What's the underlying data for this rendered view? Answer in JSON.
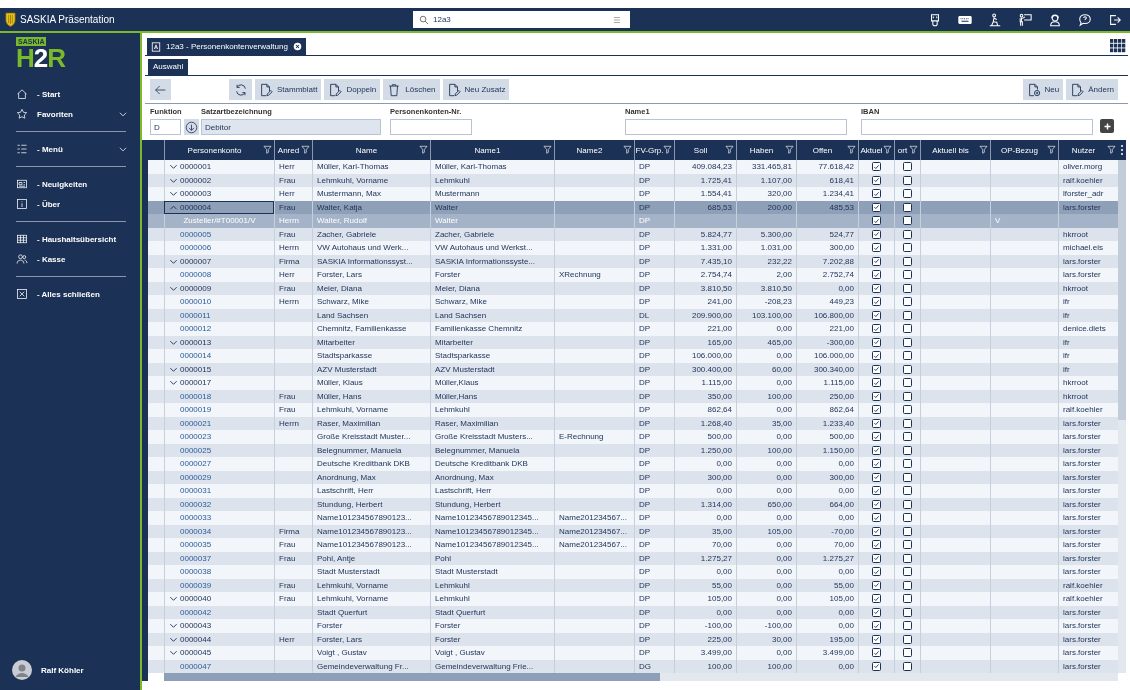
{
  "window": {
    "title": "SASKIA Präsentation"
  },
  "search": {
    "value": "12a3"
  },
  "sidebar": {
    "logo_badge": "SASKIA",
    "logo_mark": "H2R",
    "groups": [
      [
        {
          "label": "- Start",
          "submenu": false
        },
        {
          "label": "Favoriten",
          "submenu": true
        }
      ],
      [
        {
          "label": "- Menü",
          "submenu": true
        }
      ],
      [
        {
          "label": "- Neuigkeiten",
          "submenu": false
        },
        {
          "label": "- Über",
          "submenu": false
        }
      ],
      [
        {
          "label": "- Haushaltsübersicht",
          "submenu": false
        },
        {
          "label": "- Kasse",
          "submenu": false
        }
      ],
      [
        {
          "label": "- Alles schließen",
          "submenu": false
        }
      ]
    ],
    "user": {
      "name": "Ralf Köhler"
    }
  },
  "document_tabs": [
    {
      "title": "12a3 - Personenkontenverwaltung",
      "selected": true
    }
  ],
  "subtabs": [
    {
      "label": "Auswahl",
      "selected": true
    }
  ],
  "toolbar": {
    "center": [
      {
        "label": "Stammblatt"
      },
      {
        "label": "Doppeln"
      },
      {
        "label": "Löschen"
      },
      {
        "label": "Neu Zusatz"
      }
    ],
    "right": [
      {
        "label": "Neu"
      },
      {
        "label": "Ändern"
      }
    ]
  },
  "filters": [
    {
      "label": "Funktion",
      "value": "D",
      "kind": "code"
    },
    {
      "label": "Satzartbezeichnung",
      "value": "Debitor",
      "kind": "readonly"
    },
    {
      "label": "Personenkonten-Nr.",
      "kind": "text"
    },
    {
      "label": "Name1",
      "kind": "text"
    },
    {
      "label": "IBAN",
      "kind": "text"
    }
  ],
  "table": {
    "columns": [
      {
        "label": "Personenkonto",
        "kind": "tree"
      },
      {
        "label": "Anred",
        "kind": "text"
      },
      {
        "label": "Name",
        "kind": "text"
      },
      {
        "label": "Name1",
        "kind": "text"
      },
      {
        "label": "Name2",
        "kind": "text"
      },
      {
        "label": "FV-Grp.",
        "kind": "text"
      },
      {
        "label": "Soll",
        "kind": "number"
      },
      {
        "label": "Haben",
        "kind": "number"
      },
      {
        "label": "Offen",
        "kind": "number"
      },
      {
        "label": "Aktuel",
        "kind": "check"
      },
      {
        "label": "ort",
        "kind": "check"
      },
      {
        "label": "Aktuell bis",
        "kind": "text"
      },
      {
        "label": "OP-Bezug",
        "kind": "text"
      },
      {
        "label": "Nutzer",
        "kind": "text"
      }
    ],
    "rows": [
      {
        "kind": "group",
        "expanded": false,
        "selected": false,
        "konto": "0000001",
        "anrede": "Herr",
        "name": "Müller, Karl-Thomas",
        "name1": "Müller, Karl-Thomas",
        "fv": "DP",
        "soll": "409.084,23",
        "haben": "331.465,81",
        "offen": "77.618,42",
        "aktuell": true,
        "ort": false,
        "nutzer": "oliver.morg"
      },
      {
        "kind": "group",
        "expanded": false,
        "selected": false,
        "konto": "0000002",
        "anrede": "Frau",
        "name": "Lehmkuhl, Vorname",
        "name1": "Lehmkuhl",
        "fv": "DP",
        "soll": "1.725,41",
        "haben": "1.107,00",
        "offen": "618,41",
        "aktuell": true,
        "ort": false,
        "nutzer": "ralf.koehler"
      },
      {
        "kind": "group",
        "expanded": false,
        "selected": false,
        "konto": "0000003",
        "anrede": "Herr",
        "name": "Mustermann, Max",
        "name1": "Mustermann",
        "fv": "DP",
        "soll": "1.554,41",
        "haben": "320,00",
        "offen": "1.234,41",
        "aktuell": true,
        "ort": false,
        "nutzer": "lforster_adr"
      },
      {
        "kind": "group",
        "expanded": true,
        "selected": true,
        "konto": "0000004",
        "anrede": "Frau",
        "name": "Walter, Katja",
        "name1": "Walter",
        "fv": "DP",
        "soll": "685,53",
        "haben": "200,00",
        "offen": "485,53",
        "aktuell": true,
        "ort": false,
        "nutzer": "lars.forster"
      },
      {
        "kind": "sub",
        "selected": false,
        "konto": "Zusteller/#T00001/V",
        "anrede": "Herrn",
        "name": "Walter, Rudolf",
        "name1": "Walter",
        "fv": "DP",
        "aktuell": true,
        "ort": false,
        "op_bezug": "V"
      },
      {
        "kind": "leaf",
        "selected": false,
        "konto": "0000005",
        "anrede": "Frau",
        "name": "Zacher, Gabriele",
        "name1": "Zacher, Gabriele",
        "fv": "DP",
        "soll": "5.824,77",
        "haben": "5.300,00",
        "offen": "524,77",
        "aktuell": true,
        "ort": false,
        "nutzer": "hkrroot"
      },
      {
        "kind": "leaf",
        "selected": false,
        "konto": "0000006",
        "anrede": "Herrn",
        "name": "VW Autohaus und Werk...",
        "name1": "VW Autohaus und Werkst...",
        "fv": "DP",
        "soll": "1.331,00",
        "haben": "1.031,00",
        "offen": "300,00",
        "aktuell": true,
        "ort": false,
        "nutzer": "michael.eis"
      },
      {
        "kind": "group",
        "expanded": false,
        "selected": false,
        "konto": "0000007",
        "anrede": "Firma",
        "name": "SASKIA Informationssyst...",
        "name1": "SASKIA Informationssyste...",
        "fv": "DP",
        "soll": "7.435,10",
        "haben": "232,22",
        "offen": "7.202,88",
        "aktuell": true,
        "ort": false,
        "nutzer": "lars.forster"
      },
      {
        "kind": "leaf",
        "selected": false,
        "konto": "0000008",
        "anrede": "Herr",
        "name": "Forster, Lars",
        "name1": "Forster",
        "name2": "XRechnung",
        "fv": "DP",
        "soll": "2.754,74",
        "haben": "2,00",
        "offen": "2.752,74",
        "aktuell": true,
        "ort": false,
        "nutzer": "lars.forster"
      },
      {
        "kind": "group",
        "expanded": false,
        "selected": false,
        "konto": "0000009",
        "anrede": "Frau",
        "name": "Meier, Diana",
        "name1": "Meier, Diana",
        "fv": "DP",
        "soll": "3.810,50",
        "haben": "3.810,50",
        "offen": "0,00",
        "aktuell": true,
        "ort": false,
        "nutzer": "hkrroot"
      },
      {
        "kind": "leaf",
        "selected": false,
        "konto": "0000010",
        "anrede": "Herrn",
        "name": "Schwarz, Mike",
        "name1": "Schwarz, Mike",
        "fv": "DP",
        "soll": "241,00",
        "haben": "-208,23",
        "offen": "449,23",
        "aktuell": true,
        "ort": false,
        "nutzer": "ifr"
      },
      {
        "kind": "leaf",
        "selected": false,
        "konto": "0000011",
        "name": "Land Sachsen",
        "name1": "Land Sachsen",
        "fv": "DL",
        "soll": "209.900,00",
        "haben": "103.100,00",
        "offen": "106.800,00",
        "aktuell": true,
        "ort": false,
        "nutzer": "ifr"
      },
      {
        "kind": "leaf",
        "selected": false,
        "konto": "0000012",
        "name": "Chemnitz, Familienkasse",
        "name1": "Familienkasse Chemnitz",
        "fv": "DP",
        "soll": "221,00",
        "haben": "0,00",
        "offen": "221,00",
        "aktuell": true,
        "ort": false,
        "nutzer": "denice.diets"
      },
      {
        "kind": "group",
        "expanded": false,
        "selected": false,
        "konto": "0000013",
        "name": "Mitarbeiter",
        "name1": "Mitarbeiter",
        "fv": "DP",
        "soll": "165,00",
        "haben": "465,00",
        "offen": "-300,00",
        "aktuell": true,
        "ort": false,
        "nutzer": "ifr"
      },
      {
        "kind": "leaf",
        "selected": false,
        "konto": "0000014",
        "name": "Stadtsparkasse",
        "name1": "Stadtsparkasse",
        "fv": "DP",
        "soll": "106.000,00",
        "haben": "0,00",
        "offen": "106.000,00",
        "aktuell": true,
        "ort": false,
        "nutzer": "ifr"
      },
      {
        "kind": "group",
        "expanded": false,
        "selected": false,
        "konto": "0000015",
        "name": "AZV Musterstadt",
        "name1": "AZV Musterstadt",
        "fv": "DP",
        "soll": "300.400,00",
        "haben": "60,00",
        "offen": "300.340,00",
        "aktuell": true,
        "ort": false,
        "nutzer": "ifr"
      },
      {
        "kind": "group",
        "expanded": false,
        "selected": false,
        "konto": "0000017",
        "name": "Müller, Klaus",
        "name1": "Müller,Klaus",
        "fv": "DP",
        "soll": "1.115,00",
        "haben": "0,00",
        "offen": "1.115,00",
        "aktuell": true,
        "ort": false,
        "nutzer": "hkrroot"
      },
      {
        "kind": "leaf",
        "selected": false,
        "konto": "0000018",
        "anrede": "Frau",
        "name": "Müller, Hans",
        "name1": "Müller,Hans",
        "fv": "DP",
        "soll": "350,00",
        "haben": "100,00",
        "offen": "250,00",
        "aktuell": true,
        "ort": false,
        "nutzer": "hkrroot"
      },
      {
        "kind": "leaf",
        "selected": false,
        "konto": "0000019",
        "anrede": "Frau",
        "name": "Lehmkuhl, Vorname",
        "name1": "Lehmkuhl",
        "fv": "DP",
        "soll": "862,64",
        "haben": "0,00",
        "offen": "862,64",
        "aktuell": true,
        "ort": false,
        "nutzer": "ralf.koehler"
      },
      {
        "kind": "leaf",
        "selected": false,
        "konto": "0000021",
        "anrede": "Herrn",
        "name": "Raser, Maximilian",
        "name1": "Raser, Maximilian",
        "fv": "DP",
        "soll": "1.268,40",
        "haben": "35,00",
        "offen": "1.233,40",
        "aktuell": true,
        "ort": false,
        "nutzer": "lars.forster"
      },
      {
        "kind": "leaf",
        "selected": false,
        "konto": "0000023",
        "name": "Große Kreisstadt Muster...",
        "name1": "Große Kreisstadt Musters...",
        "name2": "E-Rechnung",
        "fv": "DP",
        "soll": "500,00",
        "haben": "0,00",
        "offen": "500,00",
        "aktuell": true,
        "ort": false,
        "nutzer": "lars.forster"
      },
      {
        "kind": "leaf",
        "selected": false,
        "konto": "0000025",
        "name": "Belegnummer, Manuela",
        "name1": "Belegnummer, Manuela",
        "fv": "DP",
        "soll": "1.250,00",
        "haben": "100,00",
        "offen": "1.150,00",
        "aktuell": true,
        "ort": false,
        "nutzer": "lars.forster"
      },
      {
        "kind": "leaf",
        "selected": false,
        "konto": "0000027",
        "name": "Deutsche Kreditbank DKB",
        "name1": "Deutsche Kreditbank DKB",
        "fv": "DP",
        "soll": "0,00",
        "haben": "0,00",
        "offen": "0,00",
        "aktuell": true,
        "ort": false,
        "nutzer": "lars.forster"
      },
      {
        "kind": "leaf",
        "selected": false,
        "konto": "0000029",
        "name": "Anordnung, Max",
        "name1": "Anordnung, Max",
        "fv": "DP",
        "soll": "300,00",
        "haben": "0,00",
        "offen": "300,00",
        "aktuell": true,
        "ort": false,
        "nutzer": "lars.forster"
      },
      {
        "kind": "leaf",
        "selected": false,
        "konto": "0000031",
        "name": "Lastschrift, Herr",
        "name1": "Lastschrift, Herr",
        "fv": "DP",
        "soll": "0,00",
        "haben": "0,00",
        "offen": "0,00",
        "aktuell": true,
        "ort": false,
        "nutzer": "lars.forster"
      },
      {
        "kind": "leaf",
        "selected": false,
        "konto": "0000032",
        "name": "Stundung, Herbert",
        "name1": "Stundung, Herbert",
        "fv": "DP",
        "soll": "1.314,00",
        "haben": "650,00",
        "offen": "664,00",
        "aktuell": true,
        "ort": false,
        "nutzer": "lars.forster"
      },
      {
        "kind": "leaf",
        "selected": false,
        "konto": "0000033",
        "name": "Name101234567890123...",
        "name1": "Name10123456789012345...",
        "name2": "Name201234567...",
        "fv": "DP",
        "soll": "0,00",
        "haben": "0,00",
        "offen": "0,00",
        "aktuell": true,
        "ort": false,
        "nutzer": "lars.forster"
      },
      {
        "kind": "leaf",
        "selected": false,
        "konto": "0000034",
        "anrede": "Firma",
        "name": "Name101234567890123...",
        "name1": "Name10123456789012345...",
        "name2": "Name201234567...",
        "fv": "DP",
        "soll": "35,00",
        "haben": "105,00",
        "offen": "-70,00",
        "aktuell": true,
        "ort": false,
        "nutzer": "lars.forster"
      },
      {
        "kind": "leaf",
        "selected": false,
        "konto": "0000035",
        "anrede": "Frau",
        "name": "Name101234567890123...",
        "name1": "Name10123456789012345...",
        "name2": "Name201234567...",
        "fv": "DP",
        "soll": "70,00",
        "haben": "0,00",
        "offen": "70,00",
        "aktuell": true,
        "ort": false,
        "nutzer": "lars.forster"
      },
      {
        "kind": "leaf",
        "selected": false,
        "konto": "0000037",
        "anrede": "Frau",
        "name": "Pohl, Antje",
        "name1": "Pohl",
        "fv": "DP",
        "soll": "1.275,27",
        "haben": "0,00",
        "offen": "1.275,27",
        "aktuell": true,
        "ort": false,
        "nutzer": "lars.forster"
      },
      {
        "kind": "leaf",
        "selected": false,
        "konto": "0000038",
        "name": "Stadt Musterstadt",
        "name1": "Stadt Musterstadt",
        "fv": "DP",
        "soll": "0,00",
        "haben": "0,00",
        "offen": "0,00",
        "aktuell": true,
        "ort": false,
        "nutzer": "lars.forster"
      },
      {
        "kind": "leaf",
        "selected": false,
        "konto": "0000039",
        "anrede": "Frau",
        "name": "Lehmkuhl, Vorname",
        "name1": "Lehmkuhl",
        "fv": "DP",
        "soll": "55,00",
        "haben": "0,00",
        "offen": "55,00",
        "aktuell": true,
        "ort": false,
        "nutzer": "ralf.koehler"
      },
      {
        "kind": "group",
        "expanded": false,
        "selected": false,
        "konto": "0000040",
        "anrede": "Frau",
        "name": "Lehmkuhl, Vorname",
        "name1": "Lehmkuhl",
        "fv": "DP",
        "soll": "105,00",
        "haben": "0,00",
        "offen": "105,00",
        "aktuell": true,
        "ort": false,
        "nutzer": "ralf.koehler"
      },
      {
        "kind": "leaf",
        "selected": false,
        "konto": "0000042",
        "name": "Stadt Querfurt",
        "name1": "Stadt Querfurt",
        "fv": "DP",
        "soll": "0,00",
        "haben": "0,00",
        "offen": "0,00",
        "aktuell": true,
        "ort": false,
        "nutzer": "lars.forster"
      },
      {
        "kind": "group",
        "expanded": false,
        "selected": false,
        "konto": "0000043",
        "name": "Forster",
        "name1": "Forster",
        "fv": "DP",
        "soll": "-100,00",
        "haben": "-100,00",
        "offen": "0,00",
        "aktuell": true,
        "ort": false,
        "nutzer": "lars.forster"
      },
      {
        "kind": "group",
        "expanded": false,
        "selected": false,
        "konto": "0000044",
        "anrede": "Herr",
        "name": "Forster, Lars",
        "name1": "Forster",
        "fv": "DP",
        "soll": "225,00",
        "haben": "30,00",
        "offen": "195,00",
        "aktuell": true,
        "ort": false,
        "nutzer": "lars.forster"
      },
      {
        "kind": "group",
        "expanded": false,
        "selected": false,
        "konto": "0000045",
        "name": "Voigt , Gustav",
        "name1": "Voigt , Gustav",
        "fv": "DP",
        "soll": "3.499,00",
        "haben": "0,00",
        "offen": "3.499,00",
        "aktuell": true,
        "ort": false,
        "nutzer": "lars.forster"
      },
      {
        "kind": "leaf",
        "selected": false,
        "konto": "0000047",
        "name": "Gemeindeverwaltung Fr...",
        "name1": "Gemeindeverwaltung Frie...",
        "fv": "DG",
        "soll": "100,00",
        "haben": "100,00",
        "offen": "0,00",
        "aktuell": true,
        "ort": false,
        "nutzer": "lars.forster"
      }
    ]
  }
}
